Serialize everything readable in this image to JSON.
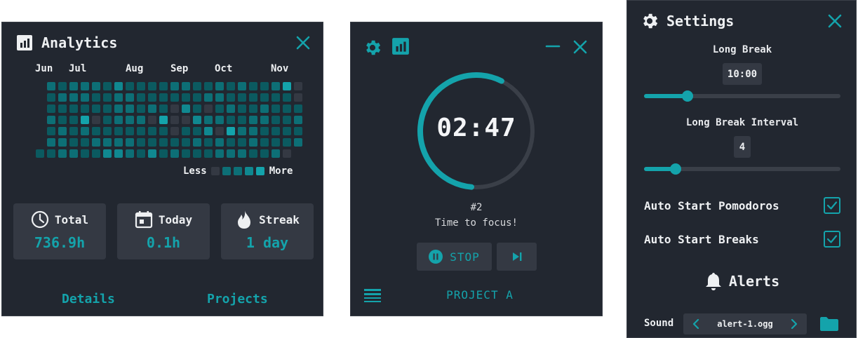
{
  "colors": {
    "accent": "#14a3ab",
    "panel_bg": "#222730",
    "card_bg": "#343943",
    "heat_levels": [
      "#343943",
      "#0b5a60",
      "#0d6f76",
      "#108890",
      "#14a3ab"
    ]
  },
  "analytics": {
    "title": "Analytics",
    "title_icon": "bar-chart-icon",
    "close_icon": "close-icon",
    "months": [
      "Jun",
      "Jul",
      "Aug",
      "Sep",
      "Oct",
      "Nov"
    ],
    "heatmap": {
      "levels": [
        [
          -1,
          2,
          1,
          2,
          2,
          2,
          1,
          3,
          1,
          1,
          1,
          1,
          2,
          2,
          1,
          1,
          2,
          1,
          2,
          1,
          1,
          2,
          4,
          0
        ],
        [
          -1,
          1,
          2,
          2,
          2,
          1,
          1,
          2,
          2,
          1,
          1,
          1,
          1,
          1,
          1,
          2,
          2,
          1,
          1,
          1,
          1,
          1,
          1,
          0
        ],
        [
          -1,
          1,
          1,
          1,
          1,
          1,
          1,
          2,
          2,
          1,
          2,
          1,
          0,
          3,
          1,
          0,
          1,
          2,
          1,
          1,
          2,
          1,
          1,
          1
        ],
        [
          -1,
          2,
          1,
          1,
          4,
          0,
          1,
          2,
          2,
          2,
          0,
          4,
          0,
          0,
          3,
          2,
          2,
          1,
          1,
          2,
          2,
          1,
          1,
          2
        ],
        [
          -1,
          1,
          2,
          1,
          2,
          1,
          1,
          1,
          1,
          1,
          1,
          1,
          0,
          1,
          1,
          3,
          0,
          4,
          2,
          2,
          1,
          1,
          1,
          1
        ],
        [
          -1,
          2,
          2,
          1,
          1,
          2,
          2,
          2,
          2,
          1,
          1,
          1,
          1,
          1,
          2,
          1,
          2,
          1,
          1,
          2,
          1,
          1,
          1,
          2
        ],
        [
          1,
          1,
          2,
          2,
          1,
          1,
          3,
          3,
          2,
          1,
          3,
          1,
          2,
          1,
          1,
          1,
          2,
          2,
          2,
          1,
          1,
          2,
          0,
          -1
        ]
      ]
    },
    "legend_less": "Less",
    "legend_more": "More",
    "stats": [
      {
        "label": "Total",
        "value": "736.9h",
        "icon": "clock-icon"
      },
      {
        "label": "Today",
        "value": "0.1h",
        "icon": "calendar-icon"
      },
      {
        "label": "Streak",
        "value": "1 day",
        "icon": "flame-icon"
      }
    ],
    "links": {
      "details": "Details",
      "projects": "Projects"
    }
  },
  "timer": {
    "time": "02:47",
    "progress": 0.56,
    "round": "#2",
    "message": "Time to focus!",
    "stop_label": "STOP",
    "project": "PROJECT A",
    "icons": [
      "gear-icon",
      "bar-chart-icon",
      "minimize-icon",
      "close-icon",
      "pause-icon",
      "skip-icon",
      "list-icon"
    ]
  },
  "settings": {
    "title": "Settings",
    "long_break": {
      "label": "Long Break",
      "value": "10:00",
      "level": 0.22
    },
    "long_break_interval": {
      "label": "Long Break Interval",
      "value": "4",
      "level": 0.16
    },
    "toggles": [
      {
        "label": "Auto Start Pomodoros",
        "checked": true
      },
      {
        "label": "Auto Start Breaks",
        "checked": true
      }
    ],
    "alerts_title": "Alerts",
    "sound_label": "Sound",
    "sound_value": "alert-1.ogg"
  }
}
